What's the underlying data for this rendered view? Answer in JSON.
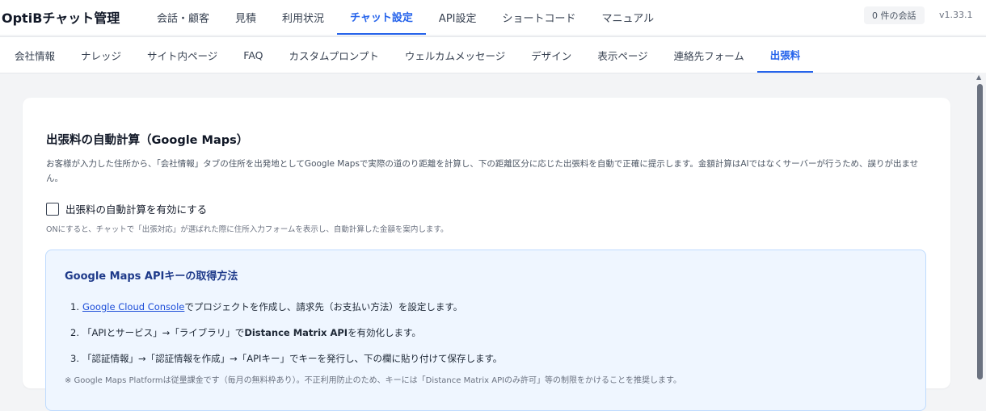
{
  "app": {
    "brand": "OptiBチャット管理",
    "conversation_count": "0 件の会話",
    "version": "v1.33.1"
  },
  "top_nav": [
    {
      "label": "会話・顧客"
    },
    {
      "label": "見積"
    },
    {
      "label": "利用状況"
    },
    {
      "label": "チャット設定",
      "active": true
    },
    {
      "label": "API設定"
    },
    {
      "label": "ショートコード"
    },
    {
      "label": "マニュアル"
    }
  ],
  "sub_nav": [
    {
      "label": "会社情報"
    },
    {
      "label": "ナレッジ"
    },
    {
      "label": "サイト内ページ"
    },
    {
      "label": "FAQ"
    },
    {
      "label": "カスタムプロンプト"
    },
    {
      "label": "ウェルカムメッセージ"
    },
    {
      "label": "デザイン"
    },
    {
      "label": "表示ページ"
    },
    {
      "label": "連絡先フォーム"
    },
    {
      "label": "出張料",
      "active": true
    }
  ],
  "section": {
    "title": "出張料の自動計算（Google Maps）",
    "description": "お客様が入力した住所から、「会社情報」タブの住所を出発地としてGoogle Mapsで実際の道のり距離を計算し、下の距離区分に応じた出張料を自動で正確に提示します。金額計算はAIではなくサーバーが行うため、誤りが出ません。",
    "toggle_label": "出張料の自動計算を有効にする",
    "toggle_checked": false,
    "toggle_help": "ONにすると、チャットで「出張対応」が選ばれた際に住所入力フォームを表示し、自動計算した金額を案内します。"
  },
  "api_info": {
    "title": "Google Maps APIキーの取得方法",
    "step1_num": "1.",
    "step1_link": "Google Cloud Console",
    "step1_text": "でプロジェクトを作成し、請求先（お支払い方法）を設定します。",
    "step2_num": "2.",
    "step2_pre": "「APIとサービス」→「ライブラリ」で ",
    "step2_bold": "Distance Matrix API",
    "step2_post": " を有効化します。",
    "step3_num": "3.",
    "step3_text": "「認証情報」→「認証情報を作成」→「APIキー」でキーを発行し、下の欄に貼り付けて保存します。",
    "note": "※ Google Maps Platformは従量課金です（毎月の無料枠あり）。不正利用防止のため、キーには「Distance Matrix APIのみ許可」等の制限をかけることを推奨します。"
  },
  "colors": {
    "accent": "#2563eb",
    "info_bg": "#eff6ff",
    "info_border": "#bfdbfe"
  }
}
